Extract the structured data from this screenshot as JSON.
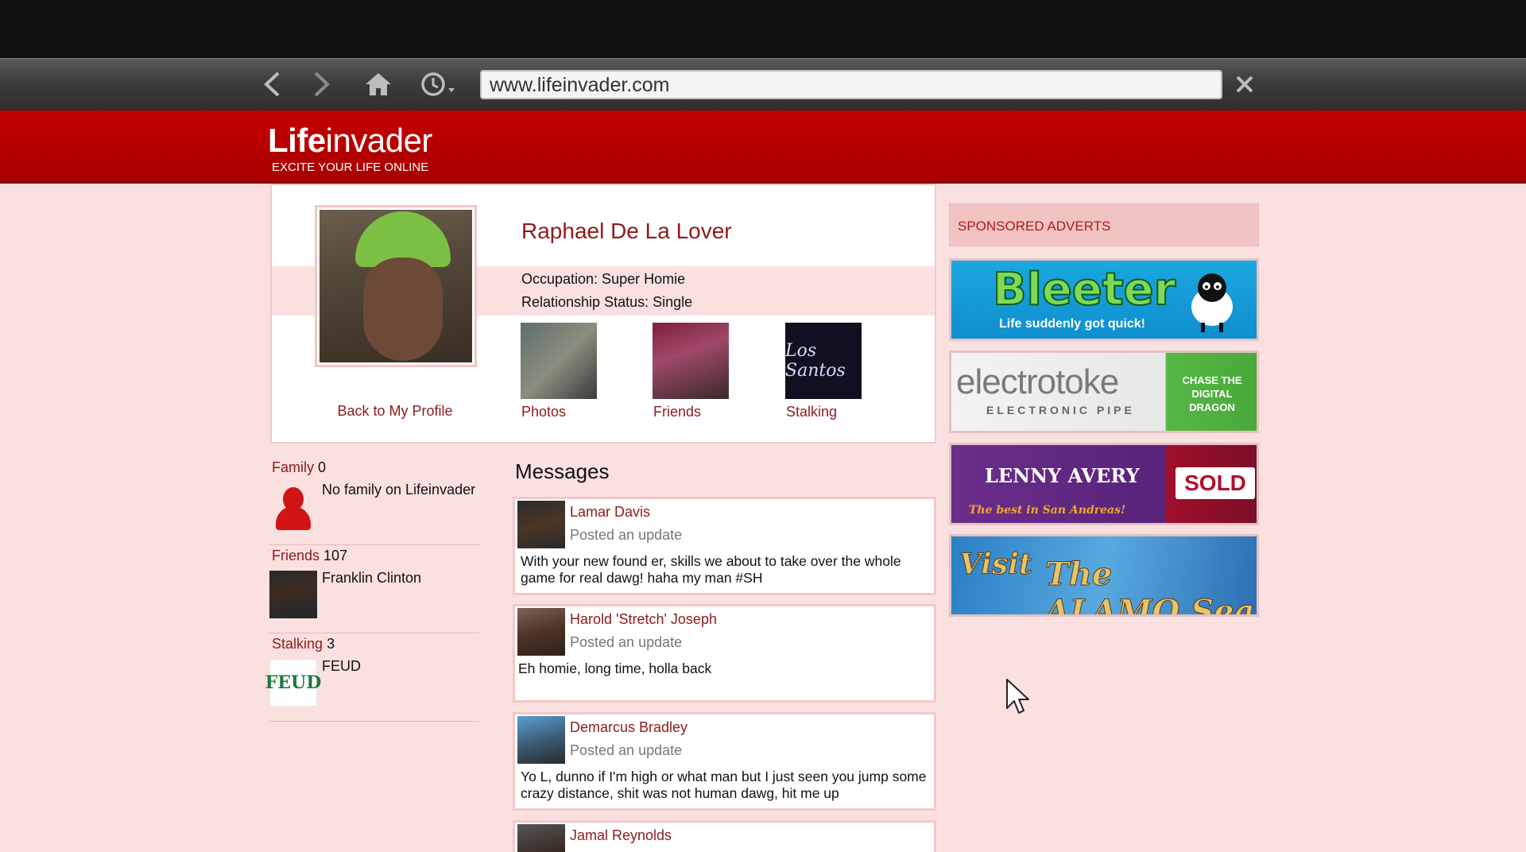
{
  "browser": {
    "url": "www.lifeinvader.com"
  },
  "site": {
    "logo_bold": "Life",
    "logo_thin": "invader",
    "tagline": "EXCITE YOUR LIFE ONLINE"
  },
  "profile": {
    "name": "Raphael De La Lover",
    "occupation": "Occupation: Super Homie",
    "relationship": "Relationship Status: Single",
    "back_link": "Back to My Profile",
    "tiles": [
      {
        "label": "Photos"
      },
      {
        "label": "Friends"
      },
      {
        "label": "Stalking",
        "thumb_text": "Los Santos"
      }
    ]
  },
  "sidebar": {
    "family": {
      "label": "Family",
      "count": "0",
      "text": "No family on Lifeinvader"
    },
    "friends": {
      "label": "Friends",
      "count": "107",
      "text": "Franklin Clinton"
    },
    "stalking": {
      "label": "Stalking",
      "count": "3",
      "text": "FEUD",
      "thumb_text": "FEUD"
    }
  },
  "messages": {
    "title": "Messages",
    "items": [
      {
        "author": "Lamar Davis",
        "sub": "Posted an update",
        "body": "With your new found er, skills we about to take over the whole game for real dawg! haha my man #SH"
      },
      {
        "author": "Harold 'Stretch' Joseph",
        "sub": "Posted an update",
        "body": "Eh homie, long time, holla back"
      },
      {
        "author": "Demarcus Bradley",
        "sub": "Posted an update",
        "body": "Yo L, dunno if I'm high or what man but I just seen you jump some crazy distance, shit was not human dawg, hit me up"
      },
      {
        "author": "Jamal Reynolds"
      }
    ]
  },
  "ads": {
    "title": "SPONSORED ADVERTS",
    "bleeter": {
      "main": "Bleeter",
      "sub": "Life suddenly got quick!"
    },
    "electrotoke": {
      "main": "electrotoke",
      "sub": "ELECTRONIC PIPE",
      "side": "CHASE THE DIGITAL DRAGON"
    },
    "lenny": {
      "main": "LENNY AVERY",
      "sub": "The best in San Andreas!",
      "side": "SOLD"
    },
    "alamo": {
      "main": "The ALAMO Sea",
      "side": "Visit"
    }
  },
  "colors": {
    "brand_red": "#b80000",
    "link_red": "#8d1b1b",
    "page_pink": "#fbe0e0"
  }
}
